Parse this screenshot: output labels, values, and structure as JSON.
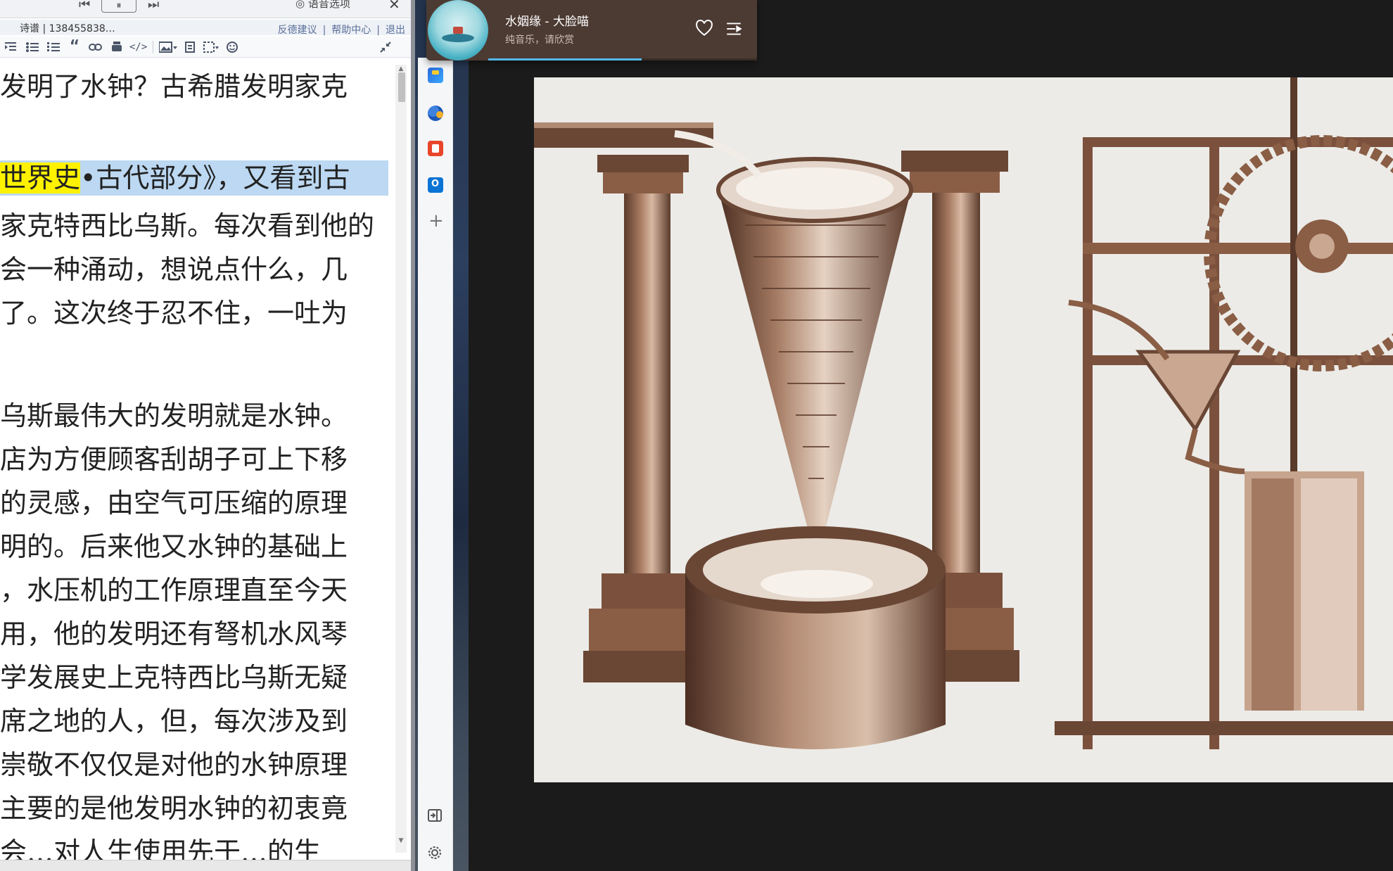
{
  "editor": {
    "media_prev": "⏮",
    "media_pause": "⏸",
    "media_next": "⏭",
    "voice_option": "语音选项",
    "close": "✕",
    "links_left": "诗谱 | 138455838…",
    "links": [
      "反德建议",
      "|",
      "帮助中心",
      "|",
      "退出"
    ],
    "toolbar_icons": [
      "indent-icon",
      "bullet-list-icon",
      "numbered-list-icon",
      "quote-icon",
      "link-icon",
      "attachment-icon",
      "code-icon",
      "image-icon",
      "page-icon",
      "template-icon",
      "emoji-icon",
      "collapse-icon"
    ],
    "toolbar_labels": {
      "quote": "“",
      "code": "</>"
    },
    "lines": [
      {
        "text": "发明了水钟？古希腊发明家克",
        "style": "normal"
      },
      {
        "text": "",
        "style": "normal"
      },
      {
        "text": "世界史",
        "style": "yellow",
        "rest": "•古代部分》，又看到古"
      },
      {
        "text": "家克特西比乌斯。每次看到他的",
        "style": "normal"
      },
      {
        "text": "会一种涌动，想说点什么，几",
        "style": "normal"
      },
      {
        "text": "了。这次终于忍不住，一吐为",
        "style": "normal"
      },
      {
        "text": "",
        "style": "normal"
      },
      {
        "text": "乌斯最伟大的发明就是水钟。",
        "style": "normal"
      },
      {
        "text": "店为方便顾客刮胡子可上下移",
        "style": "normal"
      },
      {
        "text": "的灵感，由空气可压缩的原理",
        "style": "normal"
      },
      {
        "text": "明的。后来他又水钟的基础上",
        "style": "normal"
      },
      {
        "text": "，水压机的工作原理直至今天",
        "style": "normal"
      },
      {
        "text": "用，他的发明还有弩机水风琴",
        "style": "normal"
      },
      {
        "text": "学发展史上克特西比乌斯无疑",
        "style": "normal"
      },
      {
        "text": "席之地的人，但，每次涉及到",
        "style": "normal"
      },
      {
        "text": "崇敬不仅仅是对他的水钟原理",
        "style": "normal"
      },
      {
        "text": "主要的是他发明水钟的初衷竟",
        "style": "normal"
      },
      {
        "text": "会…对人生使用先于…的生",
        "style": "normal"
      }
    ]
  },
  "music": {
    "title": "水姻缘 - 大脸喵",
    "subtitle": "纯音乐，请欣赏",
    "progress": 0.57,
    "accent": "#53b8e8",
    "bg": "#4c3b33"
  },
  "viewer": {
    "image_subject": "water-clock-engraving",
    "bg": "#1b1b1b",
    "sepia": "#8a5d45"
  },
  "rail_icons": [
    "briefcase-icon",
    "people-icon",
    "office-icon",
    "outlook-icon",
    "add-icon",
    "sidebar-toggle-icon",
    "settings-icon"
  ]
}
